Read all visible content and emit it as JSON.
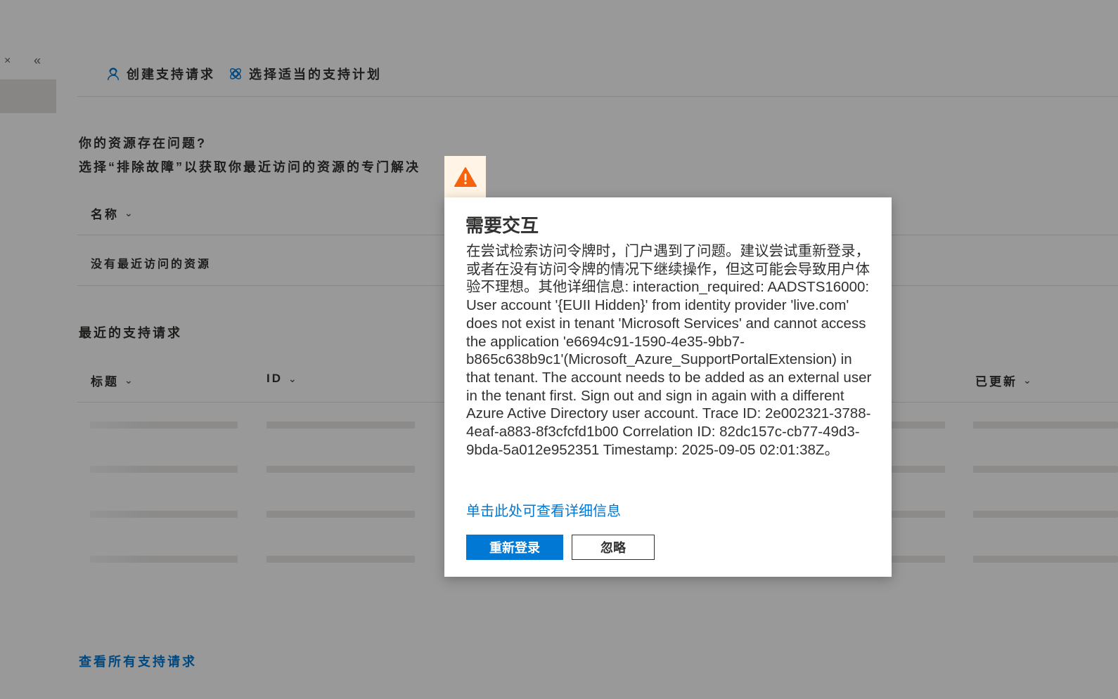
{
  "nav": {
    "close_glyph": "×",
    "collapse_glyph": "«"
  },
  "commands": [
    {
      "label": "创建支持请求",
      "icon": "person-headset-icon"
    },
    {
      "label": "选择适当的支持计划",
      "icon": "support-plan-icon"
    }
  ],
  "resources": {
    "heading": "你的资源存在问题?",
    "subheading": "选择“排除故障”以获取你最近访问的资源的专门解决",
    "column_name": "名称",
    "empty_text": "没有最近访问的资源"
  },
  "requests": {
    "heading": "最近的支持请求",
    "columns": [
      "标题",
      "ID",
      "已更新"
    ],
    "view_all": "查看所有支持请求"
  },
  "dialog": {
    "title": "需要交互",
    "message": "在尝试检索访问令牌时，门户遇到了问题。建议尝试重新登录，或者在没有访问令牌的情况下继续操作，但这可能会导致用户体验不理想。其他详细信息: interaction_required: AADSTS16000: User account '{EUII Hidden}' from identity provider 'live.com' does not exist in tenant 'Microsoft Services' and cannot access the application 'e6694c91-1590-4e35-9bb7-b865c638b9c1'(Microsoft_Azure_SupportPortalExtension) in that tenant. The account needs to be added as an external user in the tenant first. Sign out and sign in again with a different Azure Active Directory user account. Trace ID: 2e002321-3788-4eaf-a883-8f3cfcfd1b00 Correlation ID: 82dc157c-cb77-49d3-9bda-5a012e952351 Timestamp: 2025-09-05 02:01:38Z。",
    "details_link": "单击此处可查看详细信息",
    "primary_button": "重新登录",
    "secondary_button": "忽略",
    "icon": "warning-icon"
  },
  "colors": {
    "accent": "#0078d4",
    "warning": "#f7630c",
    "overlay": "rgba(0,0,0,0.40)"
  }
}
